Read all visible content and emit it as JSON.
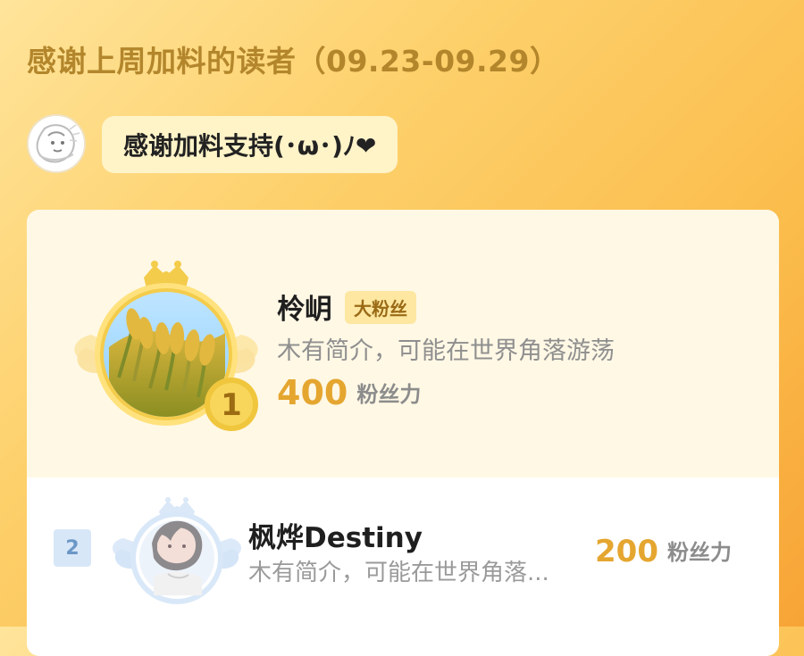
{
  "header": {
    "title": "感谢上周加料的读者（09.23-09.29）"
  },
  "message": {
    "text": "感谢加料支持(･ω･)ﾉ❤"
  },
  "leaderboard": {
    "entries": [
      {
        "rank": "1",
        "name": "柃岄",
        "badge": "大粉丝",
        "bio": "木有简介，可能在世界角落游荡",
        "score": "400",
        "unit": "粉丝力"
      },
      {
        "rank": "2",
        "name": "枫烨Destiny",
        "bio": "木有简介，可能在世界角落...",
        "score": "200",
        "unit": "粉丝力"
      }
    ]
  },
  "colors": {
    "gold": "#e5a630",
    "soft_gold": "#f4cc4b",
    "light_blue": "#d8e7f8",
    "text_gray": "#8f8f8f"
  },
  "icons": {
    "avatar": "anime-sketch-avatar",
    "medal_1": "crown-wings-medal-icon",
    "medal_2": "rank-two-medal-icon"
  }
}
